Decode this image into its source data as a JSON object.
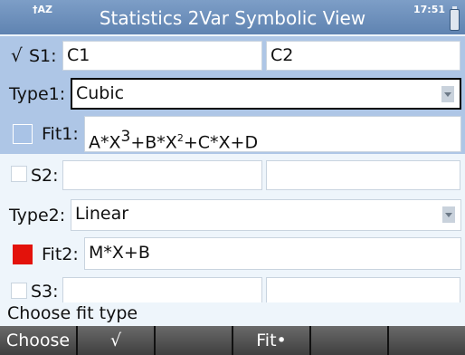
{
  "status": {
    "mode": "†AZ",
    "clock": "17:51"
  },
  "header": {
    "title": "Statistics 2Var Symbolic View"
  },
  "s1": {
    "check": "√",
    "label": "S1:",
    "x_col": "C1",
    "y_col": "C2"
  },
  "type1": {
    "label": "Type1:",
    "value": "Cubic"
  },
  "fit1": {
    "label": "Fit1:",
    "formula_parts": [
      "A*X",
      "3",
      "+B*X",
      "2",
      "+C*X+D"
    ],
    "color": "#a9c3e6"
  },
  "s2": {
    "label": "S2:"
  },
  "type2": {
    "label": "Type2:",
    "value": "Linear"
  },
  "fit2": {
    "label": "Fit2:",
    "formula": "M*X+B",
    "color": "#e3120b"
  },
  "s3": {
    "label": "S3:"
  },
  "hint": "Choose fit type",
  "softkeys": [
    "Choose",
    "√",
    "",
    "Fit•",
    "",
    ""
  ]
}
